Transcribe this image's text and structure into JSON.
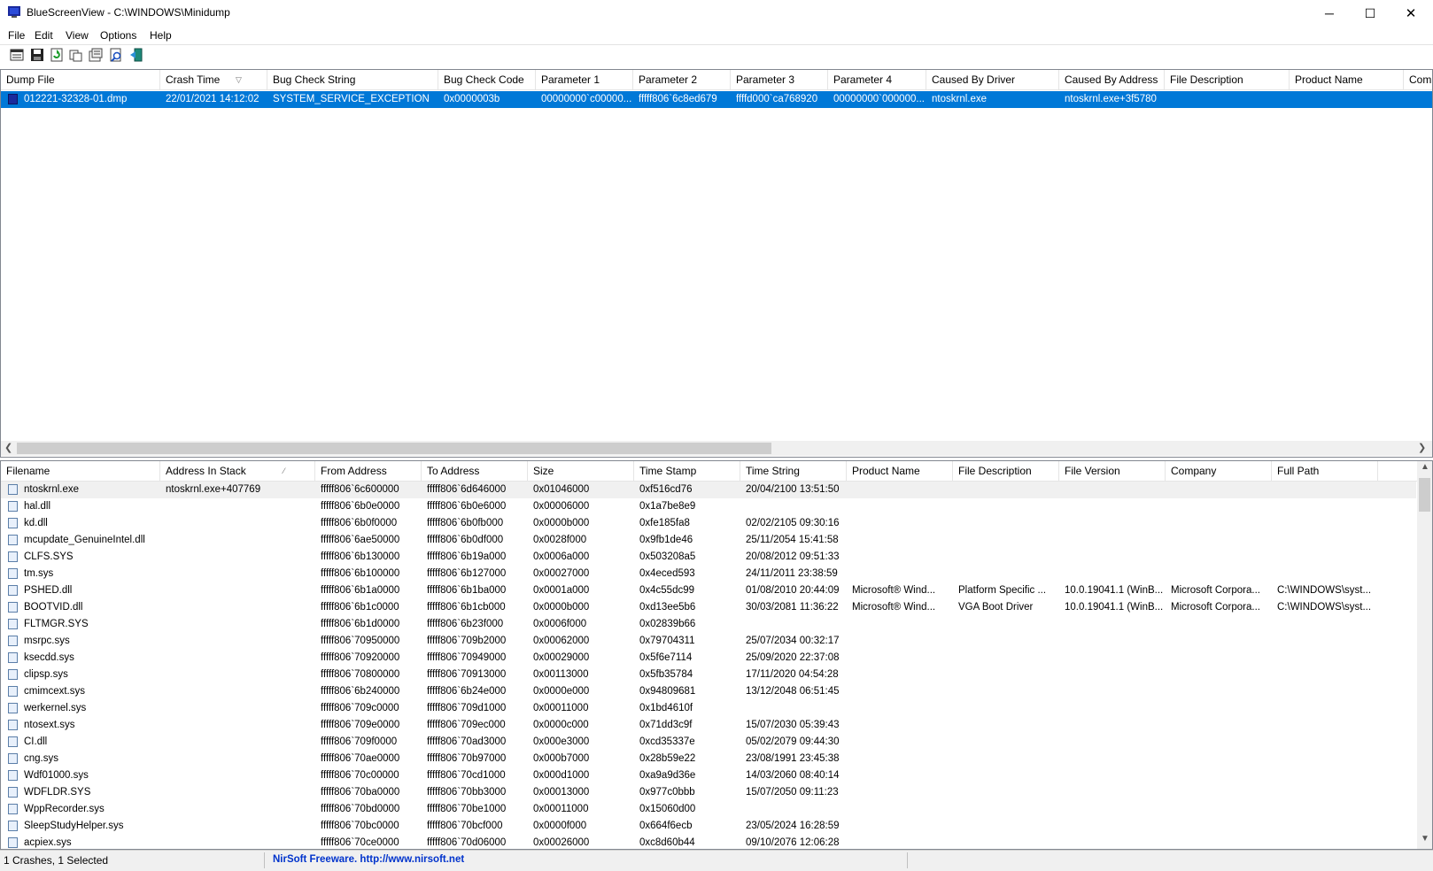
{
  "window": {
    "title": "BlueScreenView  -  C:\\WINDOWS\\Minidump",
    "minimize": "─",
    "maximize": "☐",
    "close": "✕"
  },
  "menu": [
    "File",
    "Edit",
    "View",
    "Options",
    "Help"
  ],
  "toolbar_icons": [
    "html-report-icon",
    "save-icon",
    "refresh-icon",
    "copy-icon",
    "properties-icon",
    "find-icon",
    "exit-icon"
  ],
  "top_table": {
    "columns": [
      "Dump File",
      "Crash Time",
      "Bug Check String",
      "Bug Check Code",
      "Parameter 1",
      "Parameter 2",
      "Parameter 3",
      "Parameter 4",
      "Caused By Driver",
      "Caused By Address",
      "File Description",
      "Product Name",
      "Com"
    ],
    "sort_arrow": "▽",
    "rows": [
      [
        "012221-32328-01.dmp",
        "22/01/2021 14:12:02",
        "SYSTEM_SERVICE_EXCEPTION",
        "0x0000003b",
        "00000000`c00000...",
        "fffff806`6c8ed679",
        "ffffd000`ca768920",
        "00000000`000000...",
        "ntoskrnl.exe",
        "ntoskrnl.exe+3f5780",
        "",
        "",
        ""
      ]
    ]
  },
  "bottom_table": {
    "columns": [
      "Filename",
      "Address In Stack",
      "From Address",
      "To Address",
      "Size",
      "Time Stamp",
      "Time String",
      "Product Name",
      "File Description",
      "File Version",
      "Company",
      "Full Path"
    ],
    "sort_arrow": "⁄",
    "rows": [
      [
        "ntoskrnl.exe",
        "ntoskrnl.exe+407769",
        "fffff806`6c600000",
        "fffff806`6d646000",
        "0x01046000",
        "0xf516cd76",
        "20/04/2100 13:51:50",
        "",
        "",
        "",
        "",
        ""
      ],
      [
        "hal.dll",
        "",
        "fffff806`6b0e0000",
        "fffff806`6b0e6000",
        "0x00006000",
        "0x1a7be8e9",
        "",
        "",
        "",
        "",
        "",
        ""
      ],
      [
        "kd.dll",
        "",
        "fffff806`6b0f0000",
        "fffff806`6b0fb000",
        "0x0000b000",
        "0xfe185fa8",
        "02/02/2105 09:30:16",
        "",
        "",
        "",
        "",
        ""
      ],
      [
        "mcupdate_GenuineIntel.dll",
        "",
        "fffff806`6ae50000",
        "fffff806`6b0df000",
        "0x0028f000",
        "0x9fb1de46",
        "25/11/2054 15:41:58",
        "",
        "",
        "",
        "",
        ""
      ],
      [
        "CLFS.SYS",
        "",
        "fffff806`6b130000",
        "fffff806`6b19a000",
        "0x0006a000",
        "0x503208a5",
        "20/08/2012 09:51:33",
        "",
        "",
        "",
        "",
        ""
      ],
      [
        "tm.sys",
        "",
        "fffff806`6b100000",
        "fffff806`6b127000",
        "0x00027000",
        "0x4eced593",
        "24/11/2011 23:38:59",
        "",
        "",
        "",
        "",
        ""
      ],
      [
        "PSHED.dll",
        "",
        "fffff806`6b1a0000",
        "fffff806`6b1ba000",
        "0x0001a000",
        "0x4c55dc99",
        "01/08/2010 20:44:09",
        "Microsoft® Wind...",
        "Platform Specific ...",
        "10.0.19041.1 (WinB...",
        "Microsoft Corpora...",
        "C:\\WINDOWS\\syst..."
      ],
      [
        "BOOTVID.dll",
        "",
        "fffff806`6b1c0000",
        "fffff806`6b1cb000",
        "0x0000b000",
        "0xd13ee5b6",
        "30/03/2081 11:36:22",
        "Microsoft® Wind...",
        "VGA Boot Driver",
        "10.0.19041.1 (WinB...",
        "Microsoft Corpora...",
        "C:\\WINDOWS\\syst..."
      ],
      [
        "FLTMGR.SYS",
        "",
        "fffff806`6b1d0000",
        "fffff806`6b23f000",
        "0x0006f000",
        "0x02839b66",
        "",
        "",
        "",
        "",
        "",
        ""
      ],
      [
        "msrpc.sys",
        "",
        "fffff806`70950000",
        "fffff806`709b2000",
        "0x00062000",
        "0x79704311",
        "25/07/2034 00:32:17",
        "",
        "",
        "",
        "",
        ""
      ],
      [
        "ksecdd.sys",
        "",
        "fffff806`70920000",
        "fffff806`70949000",
        "0x00029000",
        "0x5f6e7114",
        "25/09/2020 22:37:08",
        "",
        "",
        "",
        "",
        ""
      ],
      [
        "clipsp.sys",
        "",
        "fffff806`70800000",
        "fffff806`70913000",
        "0x00113000",
        "0x5fb35784",
        "17/11/2020 04:54:28",
        "",
        "",
        "",
        "",
        ""
      ],
      [
        "cmimcext.sys",
        "",
        "fffff806`6b240000",
        "fffff806`6b24e000",
        "0x0000e000",
        "0x94809681",
        "13/12/2048 06:51:45",
        "",
        "",
        "",
        "",
        ""
      ],
      [
        "werkernel.sys",
        "",
        "fffff806`709c0000",
        "fffff806`709d1000",
        "0x00011000",
        "0x1bd4610f",
        "",
        "",
        "",
        "",
        "",
        ""
      ],
      [
        "ntosext.sys",
        "",
        "fffff806`709e0000",
        "fffff806`709ec000",
        "0x0000c000",
        "0x71dd3c9f",
        "15/07/2030 05:39:43",
        "",
        "",
        "",
        "",
        ""
      ],
      [
        "CI.dll",
        "",
        "fffff806`709f0000",
        "fffff806`70ad3000",
        "0x000e3000",
        "0xcd35337e",
        "05/02/2079 09:44:30",
        "",
        "",
        "",
        "",
        ""
      ],
      [
        "cng.sys",
        "",
        "fffff806`70ae0000",
        "fffff806`70b97000",
        "0x000b7000",
        "0x28b59e22",
        "23/08/1991 23:45:38",
        "",
        "",
        "",
        "",
        ""
      ],
      [
        "Wdf01000.sys",
        "",
        "fffff806`70c00000",
        "fffff806`70cd1000",
        "0x000d1000",
        "0xa9a9d36e",
        "14/03/2060 08:40:14",
        "",
        "",
        "",
        "",
        ""
      ],
      [
        "WDFLDR.SYS",
        "",
        "fffff806`70ba0000",
        "fffff806`70bb3000",
        "0x00013000",
        "0x977c0bbb",
        "15/07/2050 09:11:23",
        "",
        "",
        "",
        "",
        ""
      ],
      [
        "WppRecorder.sys",
        "",
        "fffff806`70bd0000",
        "fffff806`70be1000",
        "0x00011000",
        "0x15060d00",
        "",
        "",
        "",
        "",
        "",
        ""
      ],
      [
        "SleepStudyHelper.sys",
        "",
        "fffff806`70bc0000",
        "fffff806`70bcf000",
        "0x0000f000",
        "0x664f6ecb",
        "23/05/2024 16:28:59",
        "",
        "",
        "",
        "",
        ""
      ],
      [
        "acpiex.sys",
        "",
        "fffff806`70ce0000",
        "fffff806`70d06000",
        "0x00026000",
        "0xc8d60b44",
        "09/10/2076 12:06:28",
        "",
        "",
        "",
        "",
        ""
      ]
    ]
  },
  "status": {
    "crashes": "1 Crashes, 1 Selected",
    "freeware": "NirSoft Freeware.  http://www.nirsoft.net"
  },
  "colors": {
    "selection": "#0078d7",
    "link": "#0033cc"
  }
}
